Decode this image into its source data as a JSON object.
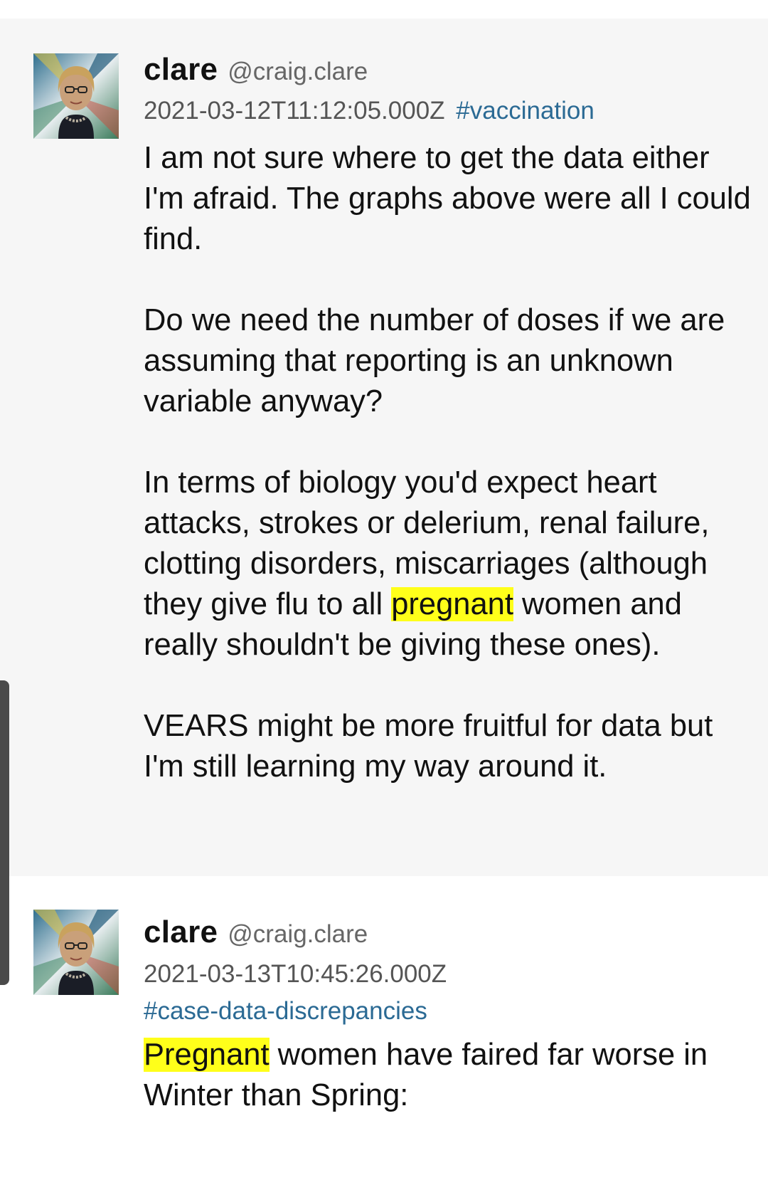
{
  "posts": [
    {
      "author": {
        "name": "clare",
        "handle": "@craig.clare"
      },
      "timestamp": "2021-03-12T11:12:05.000Z",
      "tag": "#vaccination",
      "body": {
        "p1": "I am not sure where to get the data either I'm afraid.  The graphs above were all I could find.",
        "p2": "Do we need the number of doses if we are assuming that reporting is an unknown variable anyway?",
        "p3_before": "In terms of biology you'd expect heart attacks, strokes or delerium, renal failure, clotting disorders, miscarriages (although they give flu to all ",
        "p3_highlight": "pregnant",
        "p3_after": " women and really shouldn't be giving these ones).",
        "p4": "VEARS might be more fruitful for data but I'm still learning my way around it."
      }
    },
    {
      "author": {
        "name": "clare",
        "handle": "@craig.clare"
      },
      "timestamp": "2021-03-13T10:45:26.000Z",
      "tag": "#case-data-discrepancies",
      "body": {
        "highlight": "Pregnant",
        "rest": " women have faired far worse in Winter than Spring:"
      }
    }
  ],
  "colors": {
    "highlight": "#ffff1a",
    "tag": "#2b6a94",
    "post_bg": "#f6f6f6"
  },
  "icons": [
    "avatar-photo",
    "scroll-handle"
  ]
}
